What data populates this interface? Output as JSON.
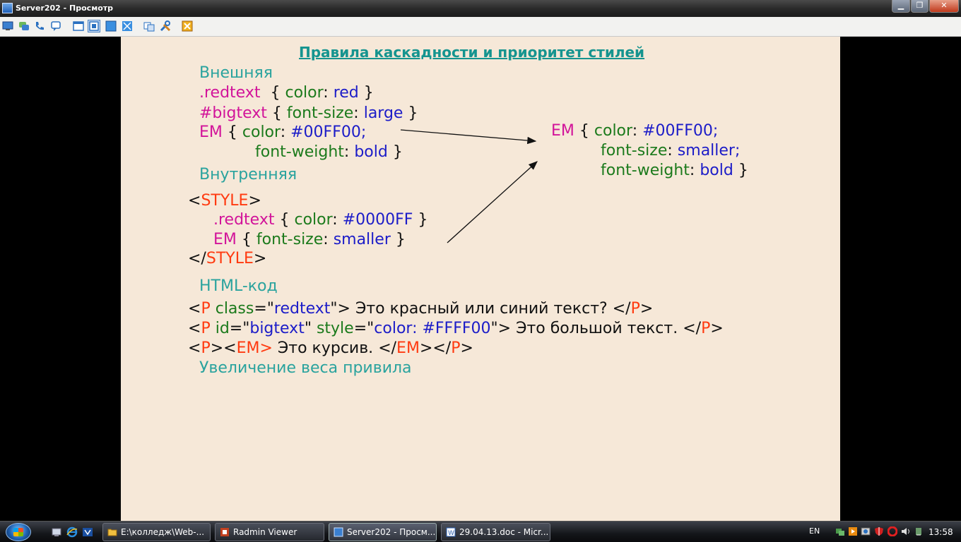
{
  "window": {
    "title": "Server202 - Просмотр",
    "min_icon": "minimize-icon",
    "max_icon": "maximize-icon",
    "close_icon": "close-icon"
  },
  "toolbar": {
    "icons": [
      "view-mode-icon",
      "chat-icon",
      "voice-chat-icon",
      "send-message-icon",
      "window-mode-icon",
      "fullscreen-icon",
      "stretch-icon",
      "scale-icon",
      "clipboard-icon",
      "settings-icon",
      "close-connection-icon"
    ]
  },
  "slide": {
    "title": "Правила каскадности и приоритет стилей",
    "external_label": "Внешняя",
    "ext1": {
      "sel": ".redtext",
      "open": "{",
      "prop": "color",
      "colon": ":",
      "val": "red",
      "close": "}"
    },
    "ext2": {
      "sel": "#bigtext",
      "open": "{",
      "prop": "font-size",
      "colon": ":",
      "val": "large",
      "close": "}"
    },
    "ext3": {
      "sel": "EM",
      "open": "{",
      "prop": "color",
      "colon": ":",
      "val": "#00FF00;"
    },
    "ext4": {
      "prop": "font-weight",
      "colon": ":",
      "val": "bold",
      "close": "}"
    },
    "internal_label": "Внутренняя",
    "style_open": {
      "lt": "<",
      "tag": "STYLE",
      "gt": ">"
    },
    "int1": {
      "sel": ".redtext",
      "open": "{",
      "prop": "color",
      "colon": ":",
      "val": "#0000FF",
      "close": "}"
    },
    "int2": {
      "sel": "EM",
      "open": "{",
      "prop": "font-size",
      "colon": ":",
      "val": "smaller",
      "close": "}"
    },
    "style_close": {
      "lt": "</",
      "tag": "STYLE",
      "gt": ">"
    },
    "result1": {
      "sel": "EM",
      "open": "{",
      "prop": "color",
      "colon": ":",
      "val": "#00FF00;"
    },
    "result2": {
      "prop": "font-size",
      "colon": ":",
      "val": "smaller;"
    },
    "result3": {
      "prop": "font-weight",
      "colon": ":",
      "val": "bold",
      "close": "}"
    },
    "html_label": "HTML-код",
    "html1": {
      "lt": "<",
      "tag": "P",
      "attr": "class",
      "eq": "=",
      "q1": "\"",
      "aval": "redtext",
      "q2": "\"",
      "gt": ">",
      "text": "Это красный или синий текст?",
      "clt": "</",
      "ctag": "P",
      "cgt": ">"
    },
    "html2": {
      "lt": "<",
      "tag": "P",
      "attr": "id",
      "eq": "=",
      "q1": "\"",
      "aval": "bigtext",
      "q2": "\"",
      "attr2": "style",
      "eq2": "=",
      "q3": "\"",
      "aval2": "color: #FFFF00",
      "q4": "\"",
      "gt": ">",
      "text": "Это большой текст.",
      "clt": "</",
      "ctag": "P",
      "cgt": ">"
    },
    "html3": {
      "lt": "<",
      "tag": "P",
      "gt": ">",
      "lt2": "<",
      "tag2": "EM",
      "gt2": ">",
      "text": "Это курсив.",
      "clt": "</",
      "ctag": "EM",
      "cgt": ">",
      "clt2": "</",
      "ctag2": "P",
      "cgt2": ">"
    },
    "weight_label": "Увеличение веса привила"
  },
  "taskbar": {
    "buttons": [
      {
        "label": "E:\\колледж\\Web-...",
        "icon": "folder-icon"
      },
      {
        "label": "Radmin Viewer",
        "icon": "radmin-icon"
      },
      {
        "label": "Server202 - Просм...",
        "icon": "radmin-window-icon"
      },
      {
        "label": "29.04.13.doc - Micr...",
        "icon": "word-icon"
      }
    ],
    "lang": "EN",
    "clock": "13:58"
  },
  "colors": {
    "slide_bg": "#f6e8d8",
    "teal": "#2aa39e",
    "magenta": "#d2149a",
    "green": "#1c7a1c",
    "blue": "#1c1cc8",
    "orange": "#ff3a10"
  }
}
